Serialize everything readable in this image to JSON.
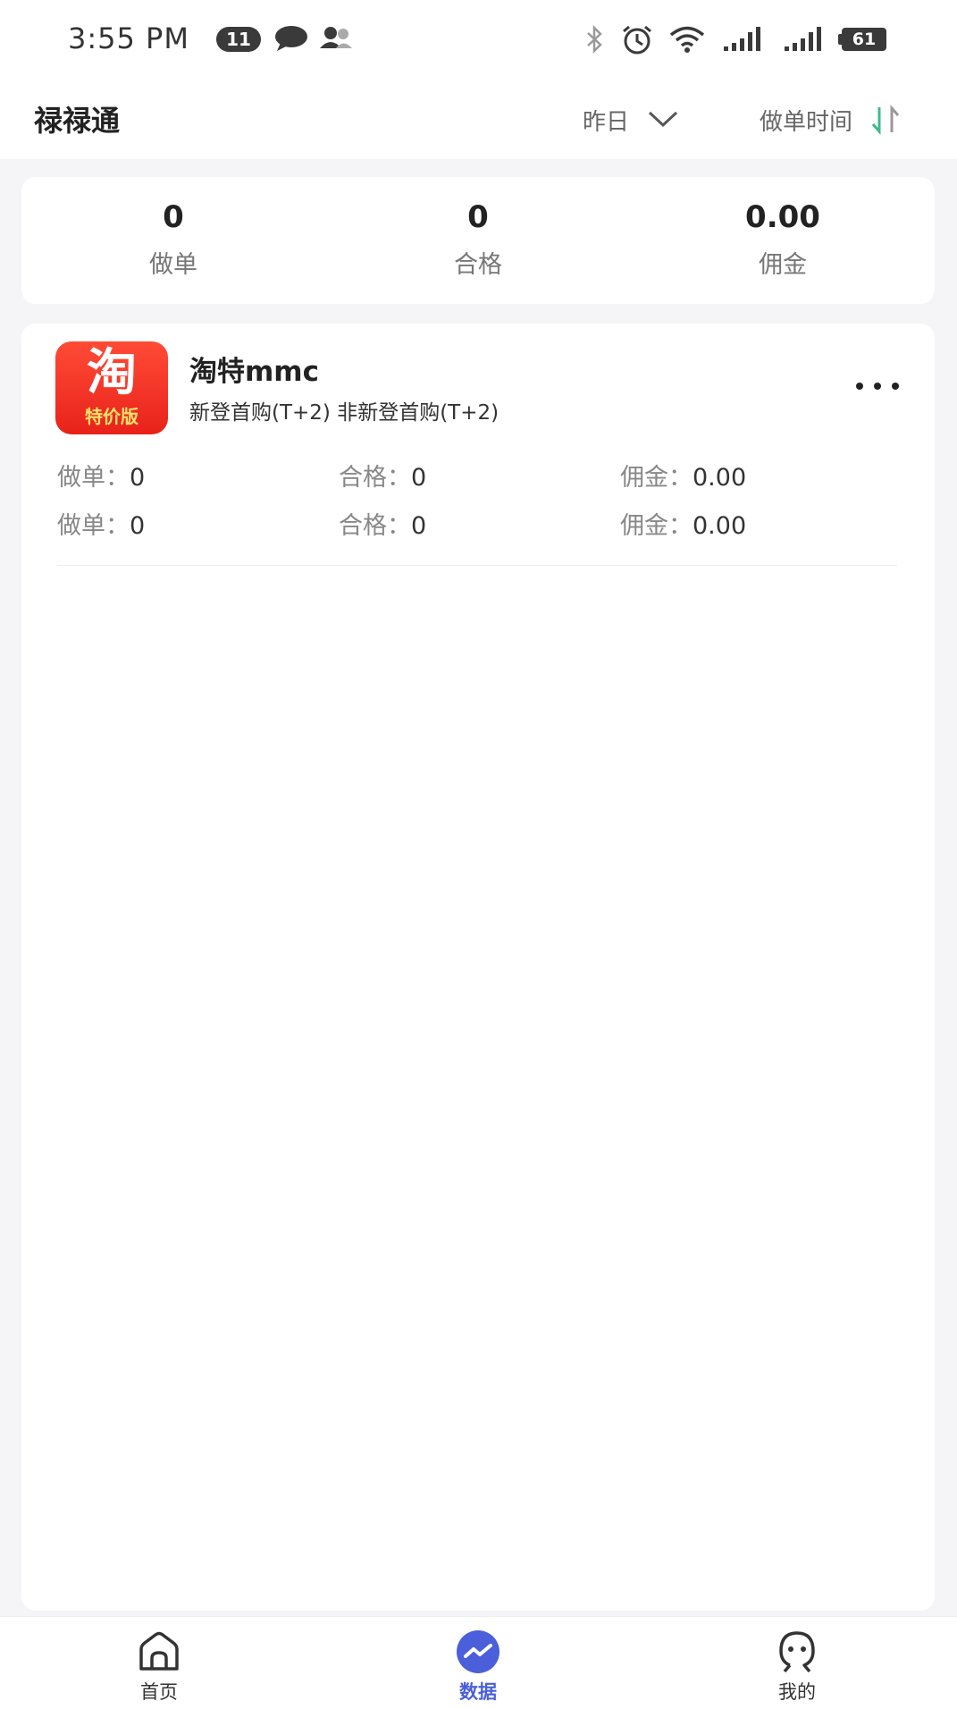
{
  "status_bar": {
    "time": "3:55 PM",
    "notification_count": "11",
    "battery": "61"
  },
  "header": {
    "app_title": "禄禄通",
    "date_filter": "昨日",
    "sort_label": "做单时间"
  },
  "summary": [
    {
      "value": "0",
      "label": "做单"
    },
    {
      "value": "0",
      "label": "合格"
    },
    {
      "value": "0.00",
      "label": "佣金"
    }
  ],
  "platform": {
    "logo_main": "淘",
    "logo_sub": "特价版",
    "name": "淘特mmc",
    "description": "新登首购(T+2)  非新登首购(T+2)",
    "rows": [
      {
        "orders_label": "做单：",
        "orders": "0",
        "qualified_label": "合格：",
        "qualified": "0",
        "commission_label": "佣金：",
        "commission": "0.00"
      },
      {
        "orders_label": "做单：",
        "orders": "0",
        "qualified_label": "合格：",
        "qualified": "0",
        "commission_label": "佣金：",
        "commission": "0.00"
      }
    ]
  },
  "tabs": [
    {
      "label": "首页",
      "icon": "home-icon",
      "active": false
    },
    {
      "label": "数据",
      "icon": "chart-icon",
      "active": true
    },
    {
      "label": "我的",
      "icon": "profile-icon",
      "active": false
    }
  ],
  "colors": {
    "accent": "#4a5fd9",
    "sort_green": "#3dbb8c",
    "logo_red": "#e8221a"
  }
}
